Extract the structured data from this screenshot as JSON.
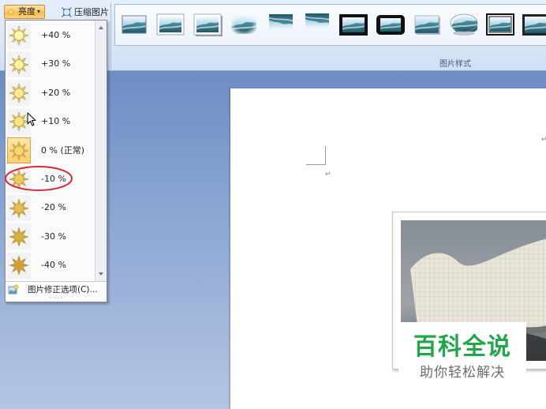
{
  "ribbon": {
    "brightness_label": "亮度",
    "brightness_arrow": "▾",
    "compress_label": "压缩图片",
    "picture_styles": {
      "group_label": "图片样式",
      "thumbnails": [
        "picture-style-simple-frame-icon",
        "picture-style-white-frame-icon",
        "picture-style-white-frame-shadow-icon",
        "picture-style-soft-edge-icon",
        "picture-style-perspective-icon",
        "picture-style-reflected-icon",
        "picture-style-thick-black-frame-icon",
        "picture-style-black-rounded-frame-icon",
        "picture-style-drop-shadow-icon",
        "picture-style-oval-icon",
        "picture-style-double-black-frame-icon",
        "picture-style-black-frame-icon"
      ]
    }
  },
  "brightness_menu": {
    "selected_index": 4,
    "items": [
      {
        "label": "+40 %",
        "sun_color": "#fff7b0"
      },
      {
        "label": "+30 %",
        "sun_color": "#fff29e"
      },
      {
        "label": "+20 %",
        "sun_color": "#ffeb8e"
      },
      {
        "label": "+10 %",
        "sun_color": "#fde380"
      },
      {
        "label": "0 % (正常)",
        "sun_color": "#f7d66c"
      },
      {
        "label": "-10 %",
        "sun_color": "#efca5d"
      },
      {
        "label": "-20 %",
        "sun_color": "#e5bc4f"
      },
      {
        "label": "-30 %",
        "sun_color": "#dbae43"
      },
      {
        "label": "-40 %",
        "sun_color": "#d1a038"
      }
    ],
    "more_options_label": "图片修正选项(C)...",
    "grip": "·····"
  },
  "document": {
    "paragraph_mark": "↵"
  },
  "watermark": {
    "title": "百科全说",
    "subtitle": "助你轻松解决"
  },
  "annotation_color": "#d42a30"
}
